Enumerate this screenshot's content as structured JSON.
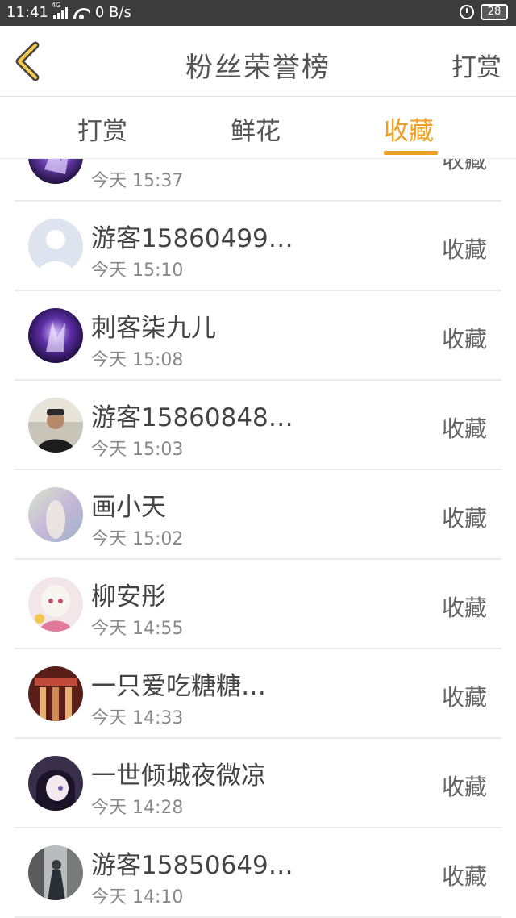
{
  "status_bar": {
    "time": "11:41",
    "network": "4G",
    "speed": "0 B/s",
    "battery": "28"
  },
  "header": {
    "title": "粉丝荣誉榜",
    "action_label": "打赏"
  },
  "tabs": [
    {
      "label": "打赏",
      "active": false
    },
    {
      "label": "鲜花",
      "active": false
    },
    {
      "label": "收藏",
      "active": true
    }
  ],
  "colors": {
    "accent": "#f0a020",
    "status_bar": "#3c3c3c",
    "divider": "#ececec"
  },
  "fans": [
    {
      "name": "",
      "time": "今天 15:37",
      "type": "收藏",
      "avatar": "purple-fantasy-avatar"
    },
    {
      "name": "游客15860499…",
      "time": "今天 15:10",
      "type": "收藏",
      "avatar": "default-user-avatar"
    },
    {
      "name": "刺客柒九儿",
      "time": "今天 15:08",
      "type": "收藏",
      "avatar": "purple-fantasy-avatar"
    },
    {
      "name": "游客15860848…",
      "time": "今天 15:03",
      "type": "收藏",
      "avatar": "photo-man-avatar"
    },
    {
      "name": "画小天",
      "time": "今天 15:02",
      "type": "收藏",
      "avatar": "anime-light-avatar"
    },
    {
      "name": "柳安彤",
      "time": "今天 14:55",
      "type": "收藏",
      "avatar": "anime-girl-avatar"
    },
    {
      "name": "一只爱吃糖糖…",
      "time": "今天 14:33",
      "type": "收藏",
      "avatar": "red-building-avatar"
    },
    {
      "name": "一世倾城夜微凉",
      "time": "今天 14:28",
      "type": "收藏",
      "avatar": "anime-dark-avatar"
    },
    {
      "name": "游客15850649…",
      "time": "今天 14:10",
      "type": "收藏",
      "avatar": "street-photo-avatar"
    }
  ]
}
